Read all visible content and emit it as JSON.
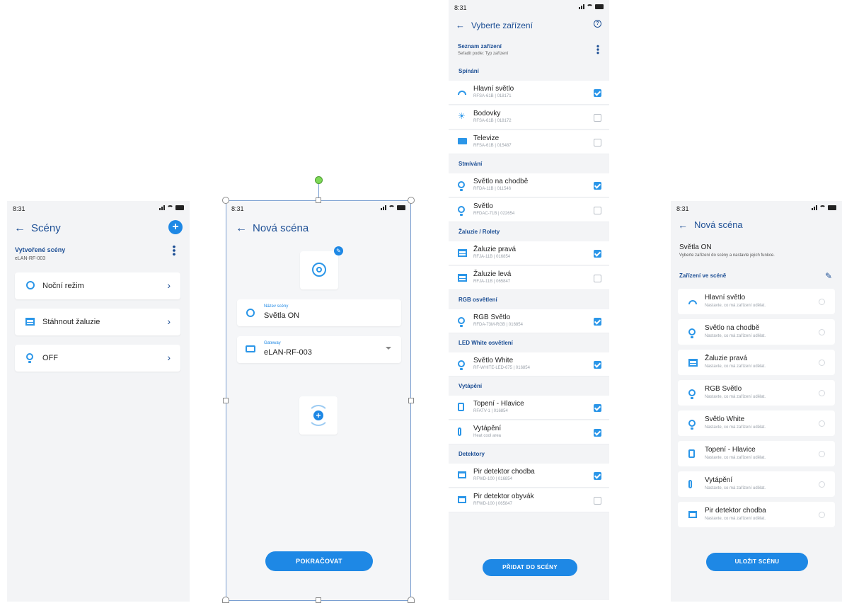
{
  "status_time": "8:31",
  "screen1": {
    "title": "Scény",
    "section_title": "Vytvořené scény",
    "section_sub": "eLAN-RF-003",
    "items": [
      {
        "label": "Noční režim",
        "icon": "night-mode-icon"
      },
      {
        "label": "Stáhnout žaluzie",
        "icon": "blinds-icon"
      },
      {
        "label": "OFF",
        "icon": "bulb-icon"
      }
    ]
  },
  "screen2": {
    "title": "Nová scéna",
    "name_label": "Název scény",
    "name_value": "Světla ON",
    "gateway_label": "Gateway",
    "gateway_value": "eLAN-RF-003",
    "button": "POKRAČOVAT"
  },
  "screen3": {
    "title": "Vyberte zařízení",
    "list_title": "Seznam zařízení",
    "list_sub": "Seřadit podle: Typ zařízení",
    "button": "PŘIDAT DO SCÉNY",
    "sections": [
      {
        "title": "Spínání",
        "items": [
          {
            "name": "Hlavní světlo",
            "sub": "RFSA-61B  |  018171",
            "checked": true,
            "icon": "lamp-icon"
          },
          {
            "name": "Bodovky",
            "sub": "RFSA-61B  |  018172",
            "checked": false,
            "icon": "spotlight-icon"
          },
          {
            "name": "Televize",
            "sub": "RFSA-61B  |  015487",
            "checked": false,
            "icon": "tv-icon"
          }
        ]
      },
      {
        "title": "Stmívání",
        "items": [
          {
            "name": "Světlo na chodbě",
            "sub": "RFDA-11B  |  011546",
            "checked": true,
            "icon": "bulb-icon"
          },
          {
            "name": "Světlo",
            "sub": "RFDAC-71B  |  022654",
            "checked": false,
            "icon": "bulb-icon"
          }
        ]
      },
      {
        "title": "Žaluzie / Rolety",
        "items": [
          {
            "name": "Žaluzie pravá",
            "sub": "RFJA-11B  |  016854",
            "checked": true,
            "icon": "blinds-icon"
          },
          {
            "name": "Žaluzie levá",
            "sub": "RFJA-11B  |  065847",
            "checked": false,
            "icon": "blinds-icon"
          }
        ]
      },
      {
        "title": "RGB osvětlení",
        "items": [
          {
            "name": "RGB Světlo",
            "sub": "RFDA-73M-RGB  |  016854",
            "checked": true,
            "icon": "bulb-icon"
          }
        ]
      },
      {
        "title": "LED White osvětlení",
        "items": [
          {
            "name": "Světlo White",
            "sub": "RF-WHITE-LED-675  |  016854",
            "checked": true,
            "icon": "bulb-icon"
          }
        ]
      },
      {
        "title": "Vytápění",
        "items": [
          {
            "name": "Topení - Hlavice",
            "sub": "RFATV-1  |  016854",
            "checked": true,
            "icon": "radiator-icon"
          },
          {
            "name": "Vytápění",
            "sub": "Heat cool area",
            "checked": true,
            "icon": "thermometer-icon"
          }
        ]
      },
      {
        "title": "Detektory",
        "items": [
          {
            "name": "Pir detektor chodba",
            "sub": "RFWD-100  |  016854",
            "checked": true,
            "icon": "detector-icon"
          },
          {
            "name": "Pir detektor obyvák",
            "sub": "RFWD-100  |  065847",
            "checked": false,
            "icon": "detector-icon"
          }
        ]
      }
    ]
  },
  "screen4": {
    "title": "Nová scéna",
    "scene_name": "Světla ON",
    "scene_hint": "Vyberte zařízení do scény a nastavte jejich funkce.",
    "section_title": "Zařízení ve scéně",
    "button": "ULOŽIT SCÉNU",
    "items": [
      {
        "name": "Hlavní světlo",
        "sub": "Nastavte, co má zařízení udělat.",
        "icon": "lamp-icon"
      },
      {
        "name": "Světlo na chodbě",
        "sub": "Nastavte, co má zařízení udělat.",
        "icon": "bulb-icon"
      },
      {
        "name": "Žaluzie pravá",
        "sub": "Nastavte, co má zařízení udělat.",
        "icon": "blinds-icon"
      },
      {
        "name": "RGB Světlo",
        "sub": "Nastavte, co má zařízení udělat.",
        "icon": "bulb-icon"
      },
      {
        "name": "Světlo White",
        "sub": "Nastavte, co má zařízení udělat.",
        "icon": "bulb-icon"
      },
      {
        "name": "Topení - Hlavice",
        "sub": "Nastavte, co má zařízení udělat.",
        "icon": "radiator-icon"
      },
      {
        "name": "Vytápění",
        "sub": "Nastavte, co má zařízení udělat.",
        "icon": "thermometer-icon"
      },
      {
        "name": "Pir detektor chodba",
        "sub": "Nastavte, co má zařízení udělat.",
        "icon": "detector-icon"
      }
    ]
  },
  "colors": {
    "accent": "#1e88e5",
    "title_blue": "#1d4f95",
    "background": "#f3f4f6"
  }
}
